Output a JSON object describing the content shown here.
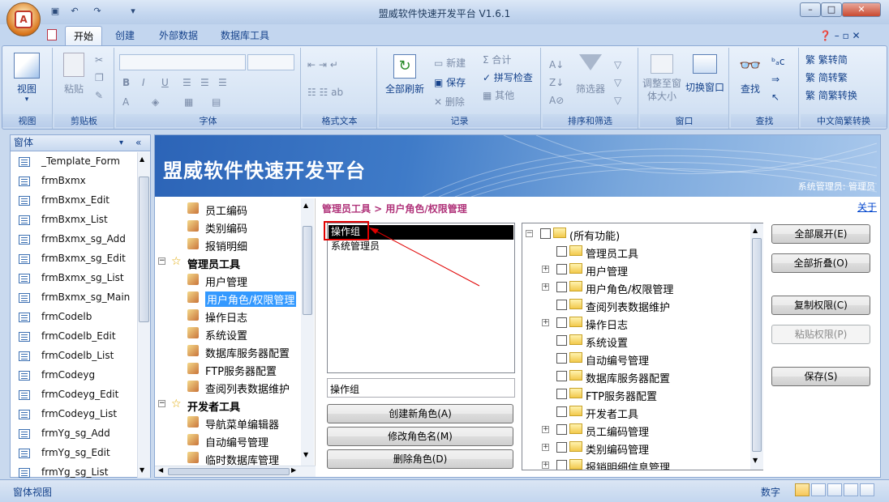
{
  "window": {
    "title": "盟威软件快速开发平台 V1.6.1",
    "controls": {
      "minimize": "–",
      "maximize": "□",
      "close": "✕"
    }
  },
  "ribbon_tabs": [
    {
      "label": "开始",
      "active": true
    },
    {
      "label": "创建"
    },
    {
      "label": "外部数据"
    },
    {
      "label": "数据库工具"
    }
  ],
  "ribbon": {
    "view_group": {
      "label": "视图",
      "btn": "视图"
    },
    "clipboard_group": {
      "label": "剪贴板",
      "paste": "粘贴"
    },
    "font_group": {
      "label": "字体",
      "bold": "B",
      "italic": "I",
      "underline": "U",
      "font_color": "A"
    },
    "rich_text_group": {
      "label": "格式文本"
    },
    "records_group": {
      "label": "记录",
      "refresh_all": "全部刷新",
      "new": "新建",
      "save": "保存",
      "delete": "删除",
      "total": "合计",
      "spelling": "拼写检查",
      "more": "其他"
    },
    "sort_filter_group": {
      "label": "排序和筛选",
      "filter": "筛选器"
    },
    "window_group": {
      "label": "窗口",
      "fit_window": "调整至窗体大小",
      "switch_window": "切换窗口"
    },
    "find_group": {
      "label": "查找",
      "find": "查找"
    },
    "chinese_group": {
      "label": "中文简繁转换",
      "trad_to_simp": "繁转简",
      "simp_to_trad": "简转繁",
      "convert": "简繁转换"
    }
  },
  "left_panel": {
    "header": "窗体",
    "collapse_glyph": "«",
    "items": [
      "_Template_Form",
      "frmBxmx",
      "frmBxmx_Edit",
      "frmBxmx_List",
      "frmBxmx_sg_Add",
      "frmBxmx_sg_Edit",
      "frmBxmx_sg_List",
      "frmBxmx_sg_Main",
      "frmCodelb",
      "frmCodelb_Edit",
      "frmCodelb_List",
      "frmCodeyg",
      "frmCodeyg_Edit",
      "frmCodeyg_List",
      "frmYg_sg_Add",
      "frmYg_sg_Edit",
      "frmYg_sg_List"
    ]
  },
  "banner": {
    "title": "盟威软件快速开发平台",
    "user": "系统管理员: 管理员"
  },
  "nav_tree": [
    {
      "label": "员工编码",
      "level": 2
    },
    {
      "label": "类别编码",
      "level": 2
    },
    {
      "label": "报销明细",
      "level": 2
    },
    {
      "label": "管理员工具",
      "level": 1,
      "bold": true
    },
    {
      "label": "用户管理",
      "level": 2
    },
    {
      "label": "用户角色/权限管理",
      "level": 2,
      "selected": true
    },
    {
      "label": "操作日志",
      "level": 2
    },
    {
      "label": "系统设置",
      "level": 2
    },
    {
      "label": "数据库服务器配置",
      "level": 2
    },
    {
      "label": "FTP服务器配置",
      "level": 2
    },
    {
      "label": "查阅列表数据维护",
      "level": 2
    },
    {
      "label": "开发者工具",
      "level": 1,
      "bold": true
    },
    {
      "label": "导航菜单编辑器",
      "level": 2
    },
    {
      "label": "自动编号管理",
      "level": 2
    },
    {
      "label": "临时数据库管理",
      "level": 2
    }
  ],
  "breadcrumb": "管理员工具 > 用户角色/权限管理",
  "about_link": "关于",
  "roles": {
    "items": [
      "操作组",
      "系统管理员"
    ],
    "selected": "操作组",
    "name_value": "操作组",
    "create_btn": "创建新角色(A)",
    "rename_btn": "修改角色名(M)",
    "delete_btn": "删除角色(D)"
  },
  "permissions": {
    "root": "(所有功能)",
    "items": [
      {
        "label": "管理员工具",
        "expandable": false
      },
      {
        "label": "用户管理",
        "expandable": true
      },
      {
        "label": "用户角色/权限管理",
        "expandable": true
      },
      {
        "label": "查阅列表数据维护",
        "expandable": false
      },
      {
        "label": "操作日志",
        "expandable": true
      },
      {
        "label": "系统设置",
        "expandable": false
      },
      {
        "label": "自动编号管理",
        "expandable": false
      },
      {
        "label": "数据库服务器配置",
        "expandable": false
      },
      {
        "label": "FTP服务器配置",
        "expandable": false
      },
      {
        "label": "开发者工具",
        "expandable": false
      },
      {
        "label": "员工编码管理",
        "expandable": true
      },
      {
        "label": "类别编码管理",
        "expandable": true
      },
      {
        "label": "报销明细信息管理",
        "expandable": true
      }
    ]
  },
  "actions": {
    "expand_all": "全部展开(E)",
    "collapse_all": "全部折叠(O)",
    "copy_perm": "复制权限(C)",
    "paste_perm": "粘贴权限(P)",
    "save": "保存(S)"
  },
  "status": {
    "left": "窗体视图",
    "mode": "数字"
  },
  "colors": {
    "accent": "#15428b",
    "selection": "#3399ff",
    "highlight_box": "#e00000"
  }
}
